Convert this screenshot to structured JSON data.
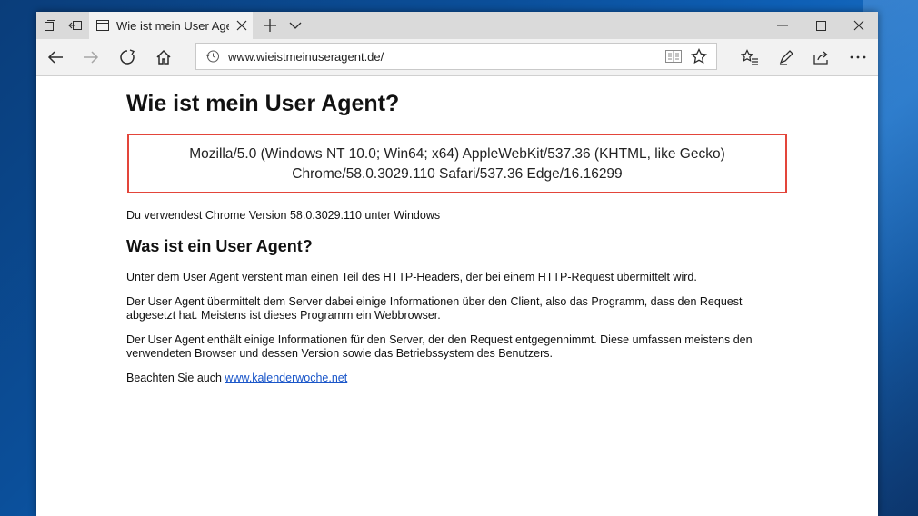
{
  "browser": {
    "tab_title": "Wie ist mein User Agent",
    "address": "www.wieistmeinuseragent.de/"
  },
  "page": {
    "heading": "Wie ist mein User Agent?",
    "ua_line1": "Mozilla/5.0 (Windows NT 10.0; Win64; x64) AppleWebKit/537.36 (KHTML, like Gecko)",
    "ua_line2": "Chrome/58.0.3029.110 Safari/537.36 Edge/16.16299",
    "detected": "Du verwendest Chrome Version 58.0.3029.110 unter Windows",
    "subheading": "Was ist ein User Agent?",
    "para1": "Unter dem User Agent versteht man einen Teil des HTTP-Headers, der bei einem HTTP-Request übermittelt wird.",
    "para2": "Der User Agent übermittelt dem Server dabei einige Informationen über den Client, also das Programm, dass den Request abgesetzt hat. Meistens ist dieses Programm ein Webbrowser.",
    "para3": "Der User Agent enthält einige Informationen für den Server, der den Request entgegennimmt. Diese umfassen meistens den verwendeten Browser und dessen Version sowie das Betriebssystem des Benutzers.",
    "see_also_prefix": "Beachten Sie auch ",
    "see_also_link": "www.kalenderwoche.net"
  },
  "colors": {
    "ua_box_border": "#e3453a",
    "link": "#1a56c9"
  }
}
